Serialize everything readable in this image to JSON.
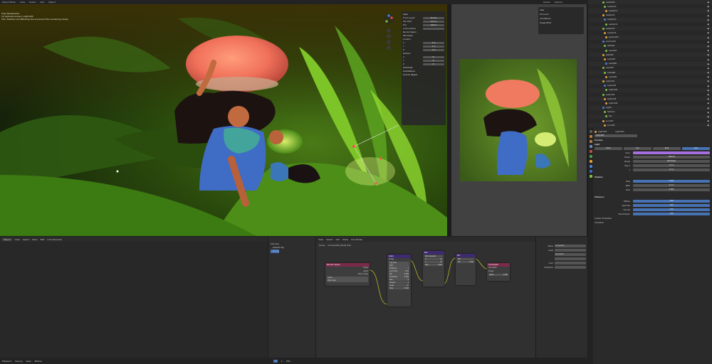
{
  "topbar": {
    "items": [
      "Object Mode",
      "View",
      "Select",
      "Add",
      "Object"
    ],
    "right": [
      "Global",
      "Options"
    ]
  },
  "viewport": {
    "info_lines": [
      "User Perspective",
      "(1) Spheres Group | Light.003",
      "Info: Shaders are affecting the scene and the rendering slowly"
    ],
    "header": [
      "Object Mode",
      "View",
      "Select",
      "Add",
      "Object"
    ],
    "n_panel": {
      "tabs": [
        "Item",
        "Tool",
        "View"
      ],
      "section_view": "View",
      "rows": [
        {
          "label": "Focal Length",
          "value": "50 mm"
        },
        {
          "label": "Clip Start",
          "value": "0.01 m"
        },
        {
          "label": "End",
          "value": "1000 m"
        },
        {
          "label": "Local Camera",
          "value": ""
        }
      ],
      "render_region": "Render Region",
      "section_3d_cursor": "3D Cursor",
      "cursor_location_label": "Location",
      "cursor_rows": [
        {
          "label": "X",
          "value": "0 m"
        },
        {
          "label": "Y",
          "value": "0 m"
        },
        {
          "label": "Z",
          "value": "0 m"
        }
      ],
      "cursor_rotation_label": "Rotation",
      "rot_rows": [
        {
          "label": "X",
          "value": "0°"
        },
        {
          "label": "Y",
          "value": "0°"
        },
        {
          "label": "Z",
          "value": "0°"
        }
      ],
      "collections": [
        "XYZ Euler",
        "Annotations",
        "Lock to Object"
      ]
    }
  },
  "preview": {
    "header": [
      "Object Mode",
      "View"
    ],
    "panel": [
      "View",
      "2D Cursor",
      "Annotations",
      "Image Editor"
    ]
  },
  "outliner": {
    "rows": [
      "Leafy.009",
      "Leafy.010",
      "Leafy.011",
      "Leafy.012",
      "Leafy.013",
      "Leafy.014",
      "Leafy.015",
      "Leafy.016",
      "plants.003",
      "plants.004",
      "leaf.002",
      "Leaf.003",
      "leaf.004",
      "Leaf.005",
      "Leaf.006",
      "Leaf.007",
      "Leaf.008",
      "Leaf.009",
      "Light.001",
      "Light.002",
      "Light.003",
      "Light.004",
      "Light.005",
      "Light.006",
      "Lights",
      "Spheres",
      "Sun",
      "sun.001",
      "sun.002",
      "sun.003"
    ]
  },
  "properties": {
    "object_name": "Light.003",
    "data_name": "Light.003",
    "light_types": [
      "Point",
      "Sun",
      "Spot",
      "Area"
    ],
    "active_type": "Area",
    "sections": {
      "preview": "Preview",
      "light": "Light",
      "shadow": "Shadow",
      "influence": "Influence",
      "custom": "Custom Properties",
      "animation": "Animation"
    },
    "light_rows": [
      {
        "label": "Color",
        "value": ""
      },
      {
        "label": "Power",
        "value": "1000 W"
      },
      {
        "label": "Shape",
        "value": "Rectangle"
      },
      {
        "label": "Size X",
        "value": "1.5 m"
      },
      {
        "label": "Y",
        "value": "1.5 m"
      }
    ],
    "shadow_rows": [
      {
        "label": "Bias",
        "value": "0.001"
      },
      {
        "label": "Jitter",
        "value": "0.2 m"
      },
      {
        "label": "Bias",
        "value": "0.000"
      }
    ],
    "influence_rows": [
      {
        "label": "Diffuse",
        "value": "1.00"
      },
      {
        "label": "Specular",
        "value": "1.00"
      },
      {
        "label": "Volume",
        "value": "1.00"
      },
      {
        "label": "Transmission",
        "value": "1.00"
      }
    ],
    "color_hex": "#a56fe0"
  },
  "file_browser": {
    "header": [
      "Object",
      "View",
      "Select",
      "Mark",
      "Edit",
      "Link Selection"
    ],
    "sidebar": [
      "Volumes",
      "Default Sky",
      "Group"
    ]
  },
  "node_editor": {
    "header": [
      "View",
      "Select",
      "Add",
      "Node",
      "Use Nodes"
    ],
    "breadcrumb": [
      "Scene",
      "Compositing Node Tree"
    ],
    "nodes": {
      "render_layers": {
        "title": "Render Layers",
        "outputs": [
          "Image",
          "Alpha",
          "Noisy Image"
        ],
        "scene": "Scene",
        "layer": "View Layer"
      },
      "glare": {
        "title": "Glare",
        "inputs": [
          "Image"
        ],
        "type": "Fog Glow",
        "quality": "High",
        "rows": [
          {
            "label": "Iterations",
            "value": "3"
          },
          {
            "label": "Color Mod.",
            "value": "0.25"
          },
          {
            "label": "Mix",
            "value": "0.000"
          },
          {
            "label": "Threshold",
            "value": "1.000"
          },
          {
            "label": "Size",
            "value": "8"
          },
          {
            "label": "Streaks",
            "value": "4"
          },
          {
            "label": "Angle",
            "value": "0°"
          },
          {
            "label": "Fade",
            "value": "0.900"
          }
        ]
      },
      "blur": {
        "title": "Blur",
        "type": "Fast Gaussian",
        "rows": [
          {
            "label": "X",
            "value": "10"
          },
          {
            "label": "Y",
            "value": "10"
          },
          {
            "label": "Size",
            "value": "1.000"
          }
        ]
      },
      "viewer": {
        "title": "Mix",
        "type": "Mix",
        "rows": [
          {
            "label": "Fac",
            "value": "1.000"
          }
        ]
      },
      "composite": {
        "title": "Composite",
        "rows": [
          {
            "label": "Use Alpha",
            "value": ""
          },
          {
            "label": "Image",
            "value": ""
          },
          {
            "label": "Alpha",
            "value": "1.000"
          }
        ]
      }
    }
  },
  "node_properties": {
    "tabs": [
      "Node",
      "Tool",
      "View",
      "Options"
    ],
    "rows": [
      {
        "label": "Name",
        "value": "Composite"
      },
      {
        "label": "Label",
        "value": ""
      },
      {
        "label": "",
        "value": "Use Alpha"
      },
      {
        "label": "",
        "value": ""
      },
      {
        "label": "Color",
        "value": ""
      },
      {
        "label": "Properties",
        "value": ""
      }
    ]
  },
  "timeline": {
    "items": [
      "Playback",
      "Keying",
      "View",
      "Marker"
    ],
    "start": "1",
    "end": "250",
    "current": "1"
  },
  "colors": {
    "accent": "#4772b3",
    "render_layers_header": "#7a2a4a",
    "glare_header": "#3e2a6e",
    "socket_yellow": "#c7c729",
    "socket_gray": "#a1a1a1"
  }
}
